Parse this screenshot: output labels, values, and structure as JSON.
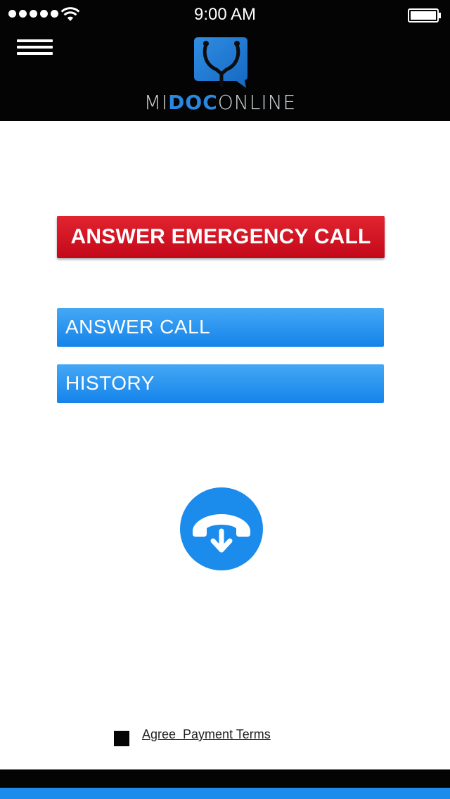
{
  "status_bar": {
    "time": "9:00 AM",
    "signal_icon": "signal-dots-icon",
    "wifi_icon": "wifi-icon",
    "battery_icon": "battery-icon"
  },
  "header": {
    "menu_icon": "hamburger-menu-icon",
    "logo_icon": "stethoscope-chat-bubble-icon",
    "logo_text": {
      "prefix": "MI",
      "middle": "DOC",
      "suffix": "ONLINE"
    }
  },
  "main": {
    "emergency_button_label": "ANSWER EMERGENCY CALL",
    "answer_call_label": "ANSWER CALL",
    "history_label": "HISTORY",
    "call_icon": "phone-download-icon"
  },
  "footer": {
    "agree_label": "Agree  Payment Terms"
  },
  "colors": {
    "header_bg": "#040404",
    "emergency_red": "#d5131f",
    "primary_blue": "#1b8bec",
    "logo_accent": "#2a87e0"
  }
}
